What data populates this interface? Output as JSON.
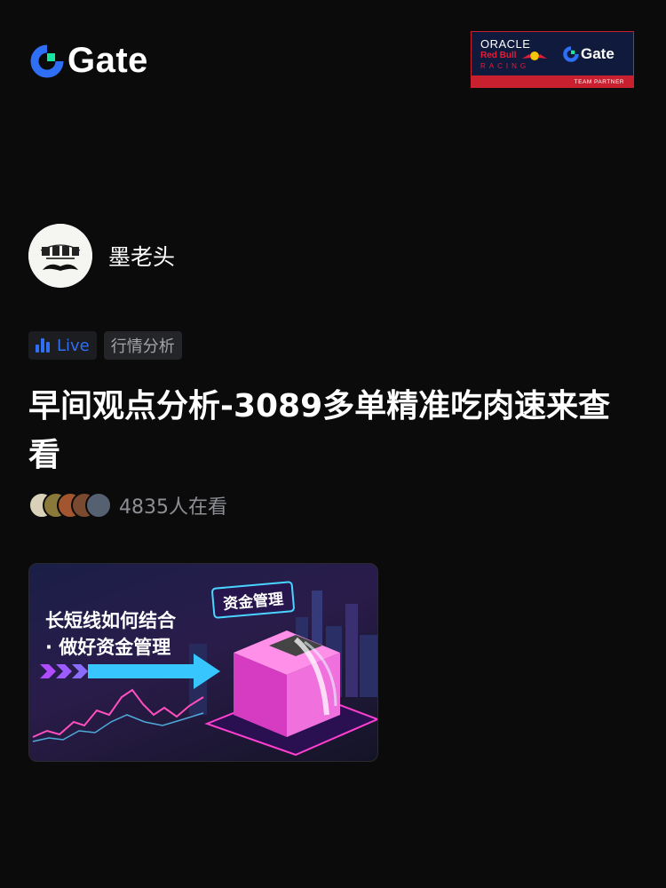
{
  "header": {
    "brand": "Gate",
    "partner": {
      "oracle": "ORACLE",
      "redbull": "Red Bull",
      "racing": "RACING",
      "brand": "Gate",
      "badge": "TEAM PARTNER"
    }
  },
  "author": {
    "name": "墨老头"
  },
  "tags": {
    "live": "Live",
    "category": "行情分析"
  },
  "post": {
    "title": "早间观点分析-3089多单精准吃肉速来查看",
    "viewers": "4835人在看"
  },
  "thumbnail": {
    "line1": "长短线如何结合",
    "line2": "· 做好资金管理",
    "badge": "资金管理"
  },
  "colors": {
    "background": "#0b0b0c",
    "accent_blue": "#2f6ff6",
    "logo_green": "#17e6a1",
    "partner_red": "#c9202f"
  }
}
